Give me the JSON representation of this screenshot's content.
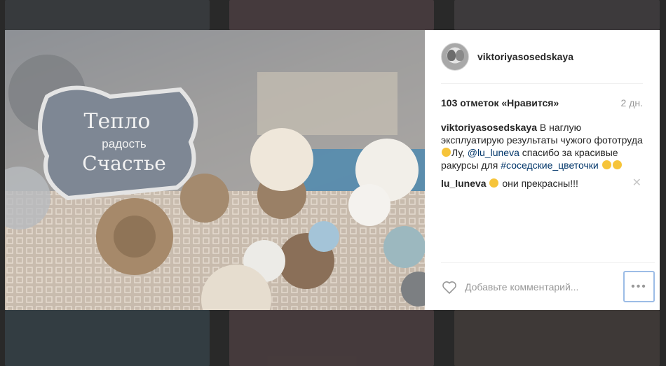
{
  "post": {
    "username": "viktoriyasosedskaya",
    "likes_text": "103 отметок «Нравится»",
    "time_ago": "2 дн.",
    "caption": {
      "author": "viktoriyasosedskaya",
      "text_part1": " В наглую эксплуатирую результаты чужого фототруда",
      "text_part2": "Лу, ",
      "mention": "@lu_luneva",
      "text_part3": " спасибо за красивые ракурсы для ",
      "hashtag": "#соседские_цветочки"
    },
    "comments": [
      {
        "author": "lu_luneva",
        "text": " они прекрасны!!!"
      }
    ],
    "photo_sign": {
      "line1": "Тепло",
      "line2": "радость",
      "line3": "Счастье"
    }
  },
  "add_comment": {
    "placeholder": "Добавьте комментарий..."
  },
  "icons": {
    "heart": "heart-outline-icon",
    "more": "more-options-icon",
    "close": "close-icon",
    "emoji": "emoji-smile-icon"
  },
  "colors": {
    "link": "#003569",
    "muted": "#999999",
    "focus_border": "#9cbce6"
  }
}
